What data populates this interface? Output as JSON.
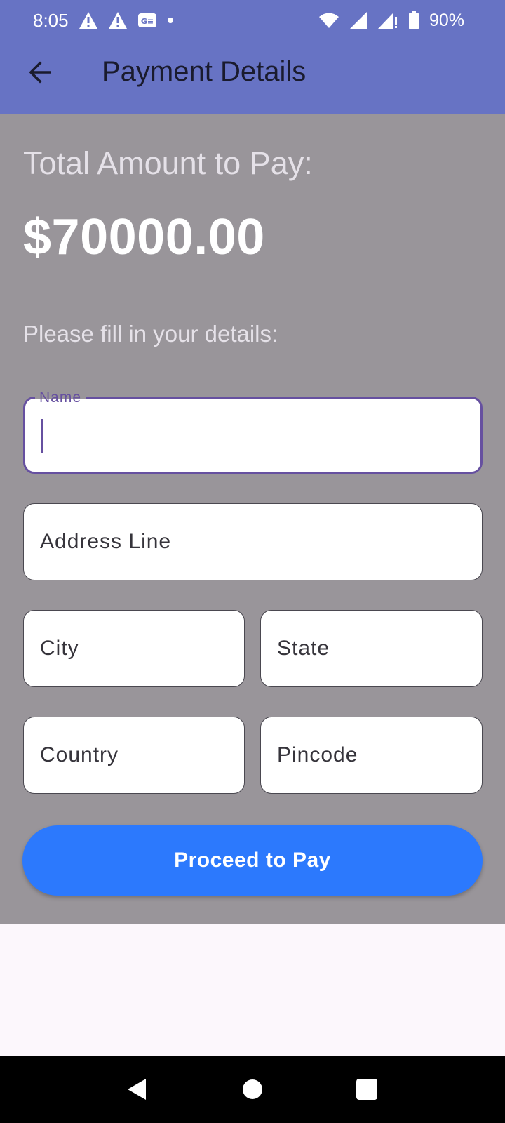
{
  "status_bar": {
    "time": "8:05",
    "battery_percent": "90%",
    "notification_icons": [
      "warning-icon",
      "warning-icon",
      "news-icon",
      "dot-icon"
    ],
    "system_icons": [
      "wifi-icon",
      "signal-icon",
      "signal-icon",
      "battery-icon"
    ]
  },
  "app_bar": {
    "title": "Payment Details",
    "back_icon": "arrow-left-icon"
  },
  "main": {
    "total_label": "Total Amount to Pay:",
    "total_amount": "$70000.00",
    "fill_prompt": "Please fill in your details:"
  },
  "form": {
    "name": {
      "label": "Name",
      "value": ""
    },
    "address": {
      "placeholder": "Address Line"
    },
    "city": {
      "placeholder": "City"
    },
    "state": {
      "placeholder": "State"
    },
    "country": {
      "placeholder": "Country"
    },
    "pincode": {
      "placeholder": "Pincode"
    },
    "submit_label": "Proceed to Pay"
  },
  "colors": {
    "app_bar": "#6773c4",
    "scrim": "#99959a",
    "button": "#2c79fd",
    "focus": "#6650a0",
    "page_background": "#fcf7fc"
  },
  "nav_bar": {
    "buttons": [
      "back-triangle-icon",
      "home-circle-icon",
      "recents-square-icon"
    ]
  }
}
